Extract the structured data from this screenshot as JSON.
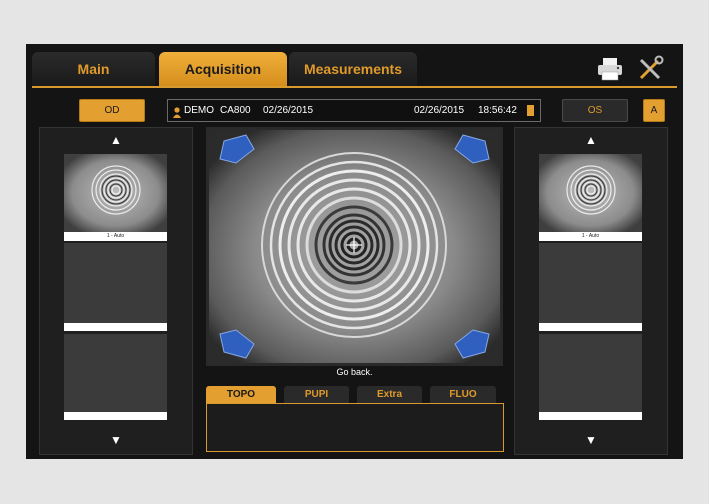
{
  "tabs": [
    {
      "label": "Main",
      "active": false
    },
    {
      "label": "Acquisition",
      "active": true
    },
    {
      "label": "Measurements",
      "active": false
    }
  ],
  "toolbar": {
    "print_icon": "printer-icon",
    "tools_icon": "tools-icon"
  },
  "eye_selector": {
    "od_label": "OD",
    "os_label": "OS",
    "auto_label": "A"
  },
  "patient": {
    "name": "DEMO",
    "id": "CA800",
    "birth_date": "02/26/2015",
    "exam_date": "02/26/2015",
    "exam_time": "18:56:42"
  },
  "left_panel": {
    "scroll_up": "▲",
    "scroll_down": "▼",
    "thumbnail_label": "1 - Auto"
  },
  "right_panel": {
    "scroll_up": "▲",
    "scroll_down": "▼",
    "thumbnail_label": "1 - Auto"
  },
  "main_view": {
    "status": "Go back."
  },
  "mode_tabs": [
    {
      "label": "TOPO",
      "active": true
    },
    {
      "label": "PUPI",
      "active": false
    },
    {
      "label": "Extra",
      "active": false
    },
    {
      "label": "FLUO",
      "active": false
    }
  ],
  "colors": {
    "accent": "#e3a030",
    "background": "#141414",
    "page": "#e5e5e5"
  }
}
